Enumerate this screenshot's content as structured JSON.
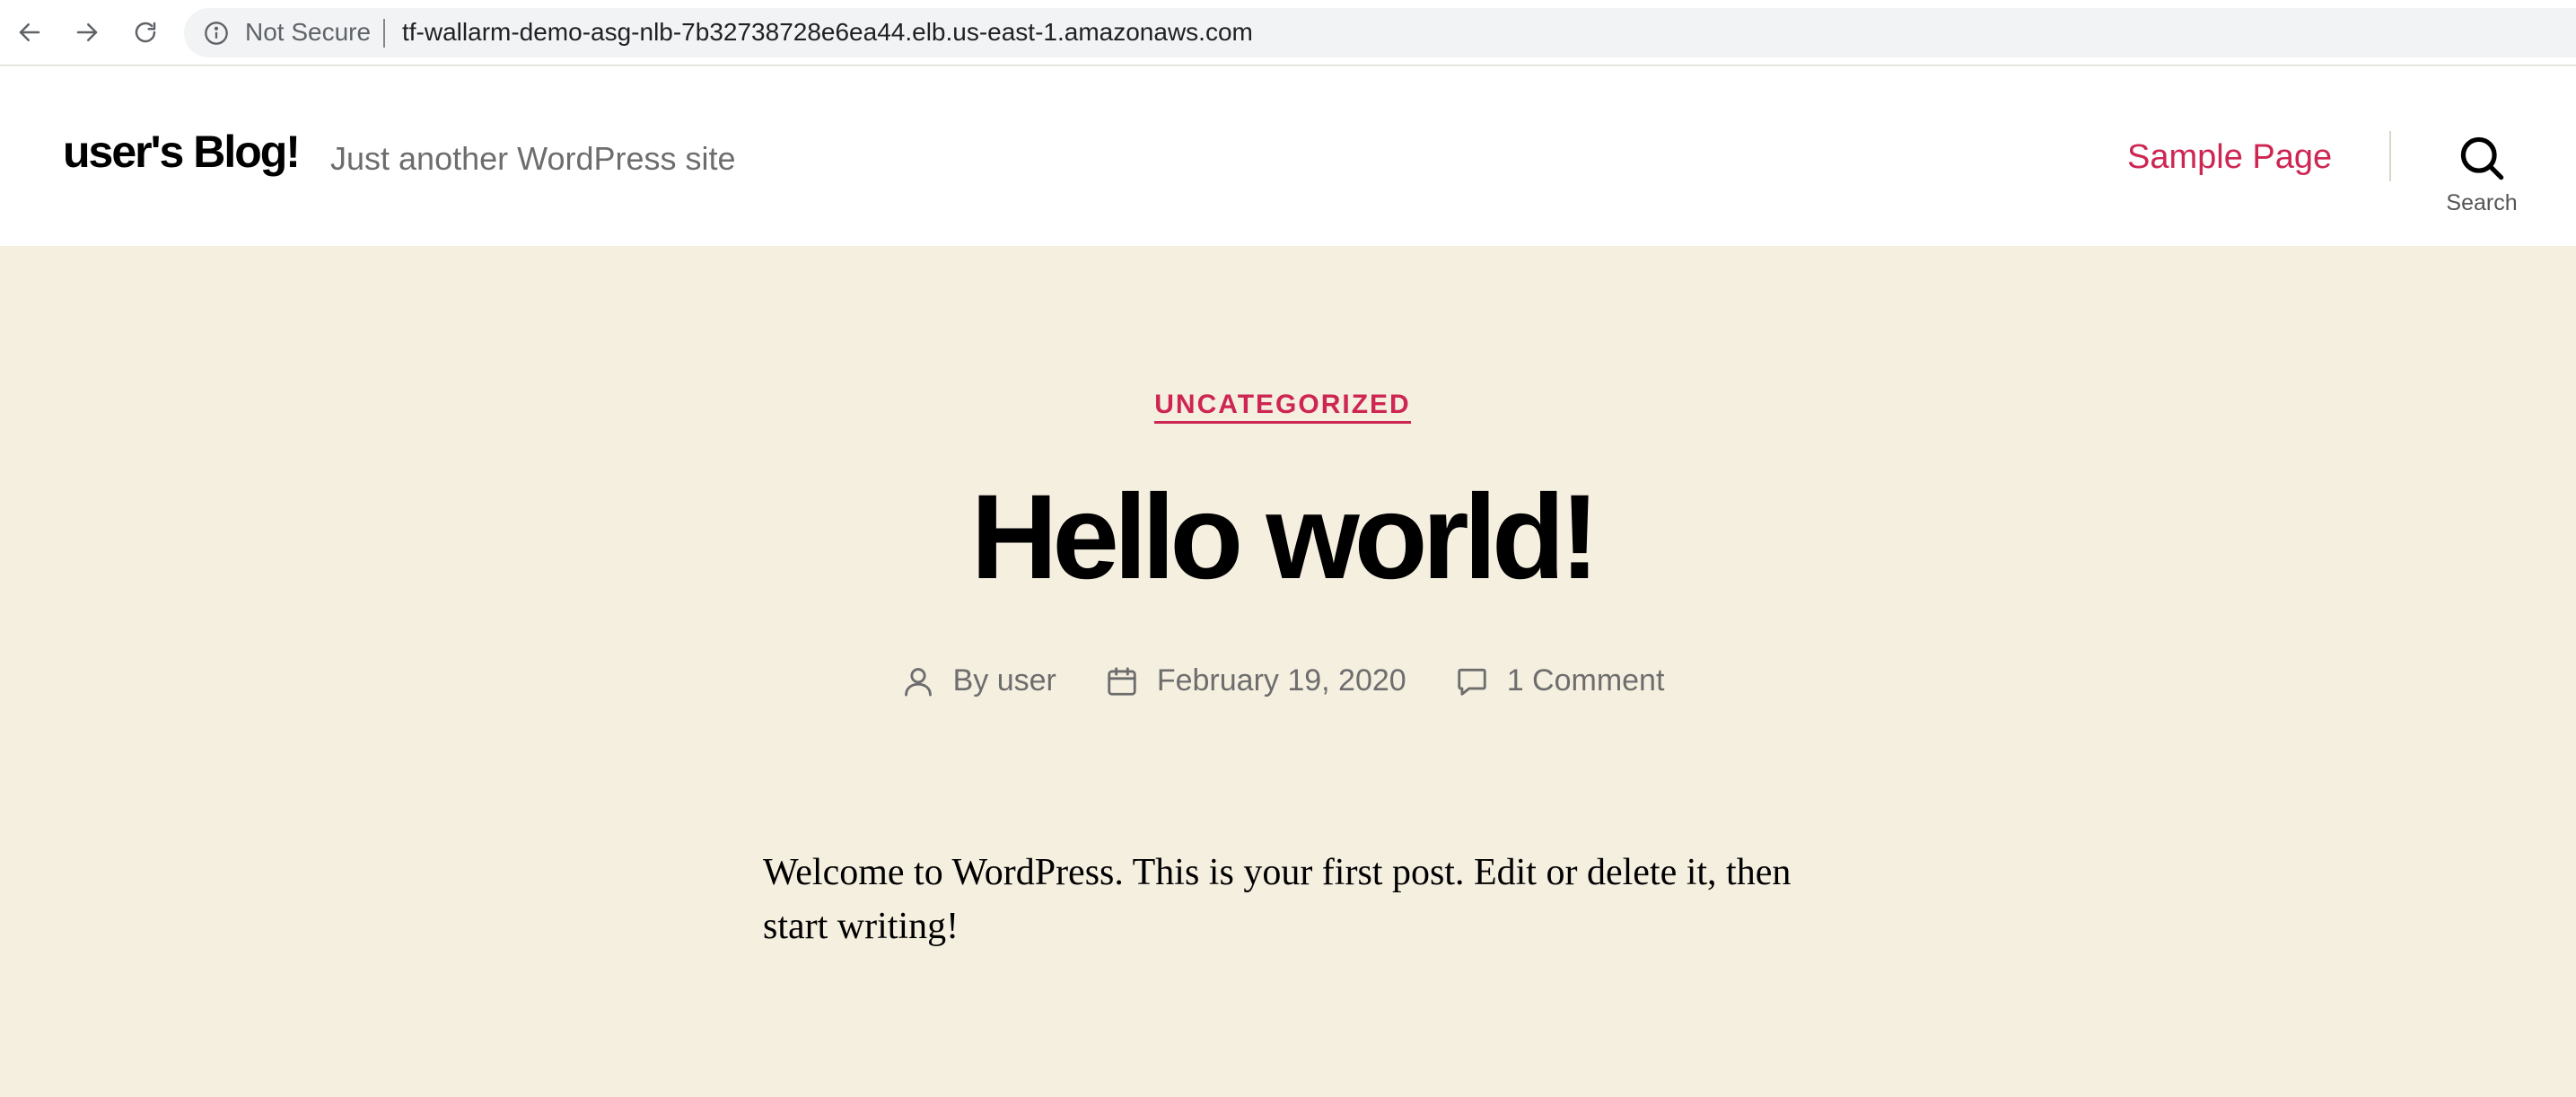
{
  "browser": {
    "security_label": "Not Secure",
    "url": "tf-wallarm-demo-asg-nlb-7b32738728e6ea44.elb.us-east-1.amazonaws.com",
    "icons": {
      "back": "arrow-left-icon",
      "forward": "arrow-right-icon",
      "reload": "reload-icon",
      "info": "info-icon"
    }
  },
  "header": {
    "site_title": "user's Blog!",
    "site_description": "Just another WordPress site",
    "menu": [
      {
        "label": "Sample Page"
      }
    ],
    "search_label": "Search"
  },
  "post": {
    "category": "UNCATEGORIZED",
    "title": "Hello world!",
    "meta": {
      "author": "By user",
      "date": "February 19, 2020",
      "comments": "1 Comment"
    },
    "content": "Welcome to WordPress. This is your first post. Edit or delete it, then start writing!"
  },
  "colors": {
    "accent": "#cd2653",
    "background": "#f5efe0",
    "header_background": "#ffffff",
    "meta_text": "#6d6d6d"
  }
}
